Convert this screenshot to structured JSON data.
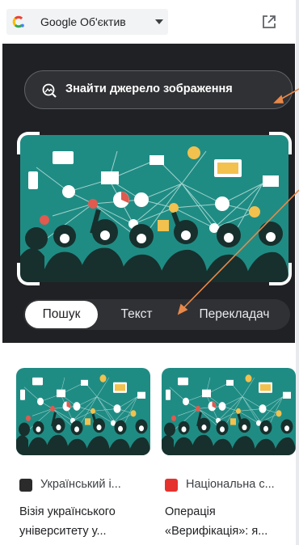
{
  "topbar": {
    "app_selector_label": "Google Об'єктив",
    "icons": [
      "google-g-icon",
      "chevron-down-icon",
      "open-in-new-icon"
    ]
  },
  "lens": {
    "find_source_label": "Знайти джерело зображення",
    "tabs": [
      {
        "label": "Пошук",
        "selected": true
      },
      {
        "label": "Текст",
        "selected": false
      },
      {
        "label": "Перекладач",
        "selected": false
      }
    ]
  },
  "results": [
    {
      "source": "Український і...",
      "title_line1": "Візія українського",
      "title_line2": "університету у..."
    },
    {
      "source": "Національна с...",
      "title_line1": "Операція",
      "title_line2": "«Верифікація»: я..."
    }
  ],
  "colors": {
    "panel_bg": "#202124",
    "image_teal": "#1f8c84",
    "annotation_arrow": "#e8894a"
  }
}
